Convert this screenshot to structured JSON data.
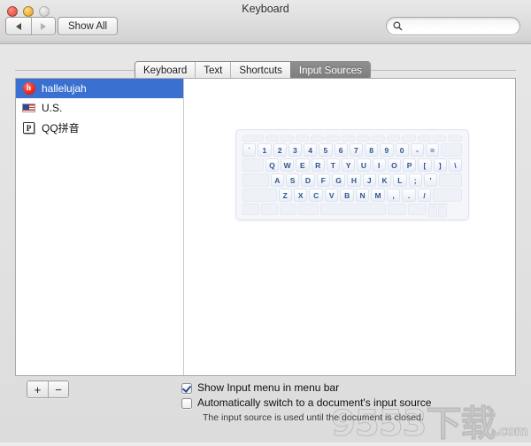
{
  "window": {
    "title": "Keyboard",
    "traffic_lights": [
      "close",
      "minimize",
      "zoom"
    ]
  },
  "toolbar": {
    "back_label": "◀",
    "forward_label": "▶",
    "show_all_label": "Show All",
    "search_placeholder": "",
    "search_value": "",
    "search_icon": "search-icon"
  },
  "tabs": [
    {
      "label": "Keyboard",
      "active": false
    },
    {
      "label": "Text",
      "active": false
    },
    {
      "label": "Shortcuts",
      "active": false
    },
    {
      "label": "Input Sources",
      "active": true
    }
  ],
  "input_sources": {
    "items": [
      {
        "label": "hallelujah",
        "icon": "hallelujah-icon",
        "selected": true
      },
      {
        "label": "U.S.",
        "icon": "us-flag-icon",
        "selected": false
      },
      {
        "label": "QQ拼音",
        "icon": "qq-pinyin-icon",
        "selected": false
      }
    ],
    "add_label": "+",
    "remove_label": "−"
  },
  "keyboard_preview": {
    "rows": [
      {
        "type": "function",
        "keys": [
          "",
          "",
          "",
          "",
          "",
          "",
          "",
          "",
          "",
          "",
          "",
          "",
          "",
          ""
        ]
      },
      {
        "type": "number",
        "keys": [
          "`",
          "1",
          "2",
          "3",
          "4",
          "5",
          "6",
          "7",
          "8",
          "9",
          "0",
          "-",
          "=",
          ""
        ]
      },
      {
        "type": "qwerty",
        "keys": [
          "",
          "Q",
          "W",
          "E",
          "R",
          "T",
          "Y",
          "U",
          "I",
          "O",
          "P",
          "[",
          "]",
          "\\"
        ]
      },
      {
        "type": "home",
        "keys": [
          "",
          "A",
          "S",
          "D",
          "F",
          "G",
          "H",
          "J",
          "K",
          "L",
          ";",
          "'",
          ""
        ]
      },
      {
        "type": "bottom_letters",
        "keys": [
          "",
          "Z",
          "X",
          "C",
          "V",
          "B",
          "N",
          "M",
          ",",
          ".",
          "/",
          ""
        ]
      },
      {
        "type": "modifiers",
        "keys": [
          "",
          "",
          "",
          "",
          "",
          "",
          "",
          "",
          ""
        ]
      }
    ]
  },
  "options": {
    "show_input_menu": {
      "label": "Show Input menu in menu bar",
      "checked": true
    },
    "auto_switch": {
      "label": "Automatically switch to a document's input source",
      "checked": false
    },
    "hint": "The input source is used until the document is closed."
  },
  "watermark": {
    "text": "9553下载",
    "suffix": ".com"
  },
  "colors": {
    "selection_blue": "#3a71d1",
    "active_tab_gray": "#858585",
    "key_text_blue": "#33538f",
    "checkbox_check": "#2c4b9b",
    "window_bg": "#e3e3e3"
  }
}
